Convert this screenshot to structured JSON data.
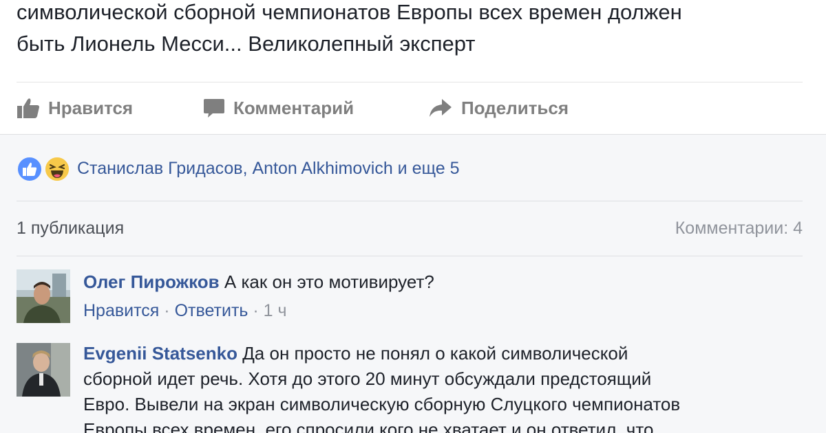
{
  "post": {
    "text_lines": [
      "символической сборной чемпионатов Европы всех времен должен",
      "быть Лионель Месси... Великолепный эксперт"
    ]
  },
  "actions": {
    "like_label": "Нравится",
    "comment_label": "Комментарий",
    "share_label": "Поделиться"
  },
  "reactions": {
    "names": "Станислав Гридасов, Anton Alkhimovich и еще 5",
    "icons": [
      "like-reaction-icon",
      "haha-reaction-icon"
    ]
  },
  "summary": {
    "shares": "1 публикация",
    "comments": "Комментарии: 4"
  },
  "comments": [
    {
      "author": "Олег Пирожков",
      "text": "А как он это мотивирует?",
      "like_label": "Нравится",
      "reply_label": "Ответить",
      "time": "1 ч"
    },
    {
      "author": "Evgenii Statsenko",
      "text_lines": [
        "Да он просто не понял о какой символической",
        "сборной идет речь. Хотя до этого 20 минут обсуждали предстоящий",
        "Евро. Вывели на экран символическую сборную Слуцкого чемпионатов",
        "Европы всех времен, его спросили кого не хватает и он ответил, что"
      ]
    }
  ],
  "colors": {
    "link": "#365899",
    "text": "#1d2129",
    "muted": "#90949c",
    "like_blue": "#5890ff",
    "haha_yellow": "#f7c94a"
  }
}
